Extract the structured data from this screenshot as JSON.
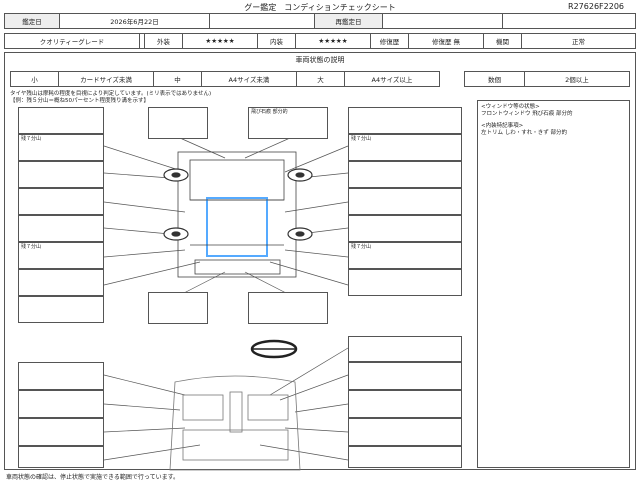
{
  "header": {
    "title": "グー鑑定　コンディションチェックシート",
    "code": "R27626F2206"
  },
  "row1": {
    "date_label": "鑑定日",
    "date_value": "2026年6月22日",
    "re_label": "再鑑定日",
    "re_value": ""
  },
  "row2": {
    "q_label": "クオリティーグレード",
    "q_value": "",
    "ext_label": "外装",
    "ext_stars": "★★★★★",
    "int_label": "内装",
    "int_stars": "★★★★★",
    "rep_label": "修復歴",
    "rep_value": "修復歴 無",
    "eq_label": "機関",
    "eq_value": "正常"
  },
  "section_title": "車両状態の説明",
  "size_row": {
    "s": "小",
    "s_desc": "カードサイズ未満",
    "m": "中",
    "m_desc": "A4サイズ未満",
    "l": "大",
    "l_desc": "A4サイズ以上",
    "count_label": "数個",
    "count_value": "2個以上"
  },
  "notes": {
    "tire1": "タイヤ残山は摩耗の程度を目視により判定しています。(ミリ表示ではありません)",
    "tire2": "【例：残５分山＝概ね50パーセント程度残り溝を示す】"
  },
  "boxes": {
    "top_center": "飛び石痕 部分的",
    "left1": "残７分山",
    "right1": "残７分山",
    "left2": "残７分山",
    "right2": "残７分山"
  },
  "right_panel": {
    "window_title": "<ウィンドウ等の状態>",
    "window_text": "フロントウィンドウ 飛び石痕 部分的",
    "interior_title": "<内装特記事項>",
    "interior_text": "左トリム しわ・すれ・きず 部分的"
  },
  "footer": "車両状態の確認は、停止状態で実施できる範囲で行っています。"
}
